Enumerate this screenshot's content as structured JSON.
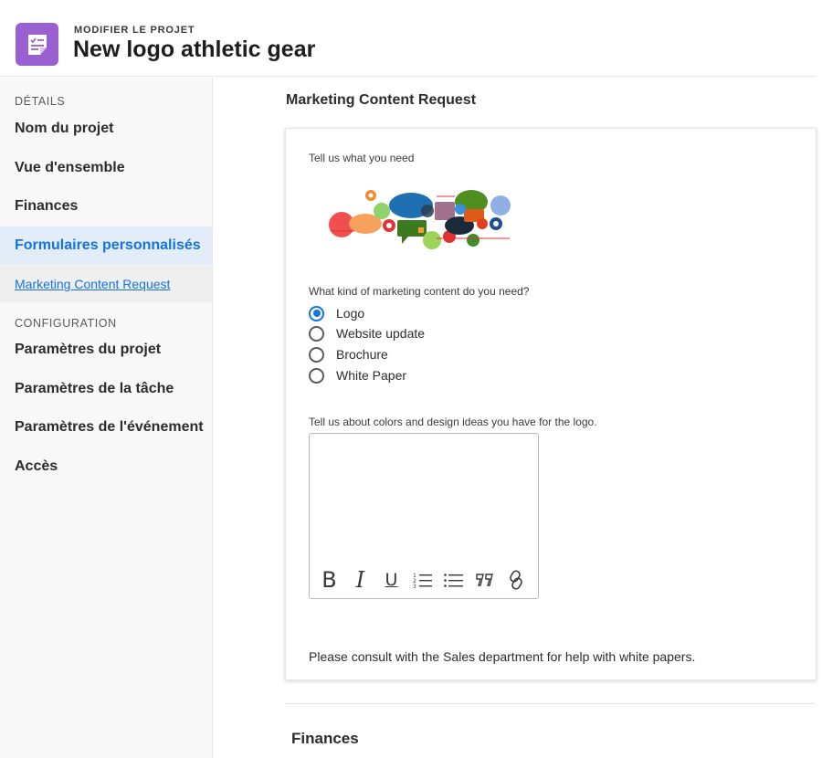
{
  "header": {
    "kicker": "MODIFIER LE PROJET",
    "title": "New logo athletic gear",
    "icon": "project-form-icon",
    "icon_color": "#9a5fd1"
  },
  "sidebar": {
    "details_label": "DÉTAILS",
    "details_items": [
      {
        "label": "Nom du projet"
      },
      {
        "label": "Vue d'ensemble"
      },
      {
        "label": "Finances"
      },
      {
        "label": "Formulaires personnalisés",
        "active": true
      }
    ],
    "sub_item": {
      "label": "Marketing Content Request"
    },
    "config_label": "CONFIGURATION",
    "config_items": [
      {
        "label": "Paramètres du projet"
      },
      {
        "label": "Paramètres de la tâche"
      },
      {
        "label": "Paramètres de l'événement"
      },
      {
        "label": "Accès"
      }
    ]
  },
  "form": {
    "title": "Marketing Content Request",
    "intro_label": "Tell us what you need",
    "illustration": "marketing-clouds-illustration",
    "question_label": "What kind of marketing content do you need?",
    "options": [
      {
        "label": "Logo",
        "checked": true
      },
      {
        "label": "Website update",
        "checked": false
      },
      {
        "label": "Brochure",
        "checked": false
      },
      {
        "label": "White Paper",
        "checked": false
      }
    ],
    "editor_label": "Tell us about colors and design ideas you have for the logo.",
    "editor_value": "",
    "toolbar": [
      "bold-icon",
      "italic-icon",
      "underline-icon",
      "numbered-list-icon",
      "bullet-list-icon",
      "quote-icon",
      "link-icon"
    ],
    "note": "Please consult with the Sales department for help with white papers."
  },
  "next_section": {
    "title": "Finances"
  },
  "colors": {
    "accent": "#1473e6",
    "active_bg": "#e3edf8"
  }
}
